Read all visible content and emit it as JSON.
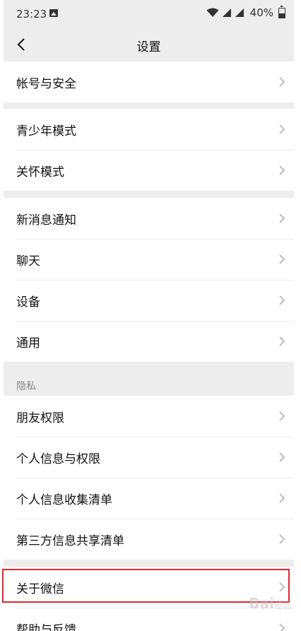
{
  "status_bar": {
    "time": "23:23",
    "battery": "40%"
  },
  "nav": {
    "title": "设置"
  },
  "groups": {
    "account": [
      "帐号与安全"
    ],
    "modes": [
      "青少年模式",
      "关怀模式"
    ],
    "general": [
      "新消息通知",
      "聊天",
      "设备",
      "通用"
    ],
    "privacy_header": "隐私",
    "privacy": [
      "朋友权限",
      "个人信息与权限",
      "个人信息收集清单",
      "第三方信息共享清单"
    ],
    "about": [
      "关于微信",
      "帮助与反馈"
    ]
  },
  "watermark": {
    "text": "Bai",
    "suffix": "经验"
  },
  "colors": {
    "highlight": "#e0262f",
    "background": "#ededed"
  }
}
